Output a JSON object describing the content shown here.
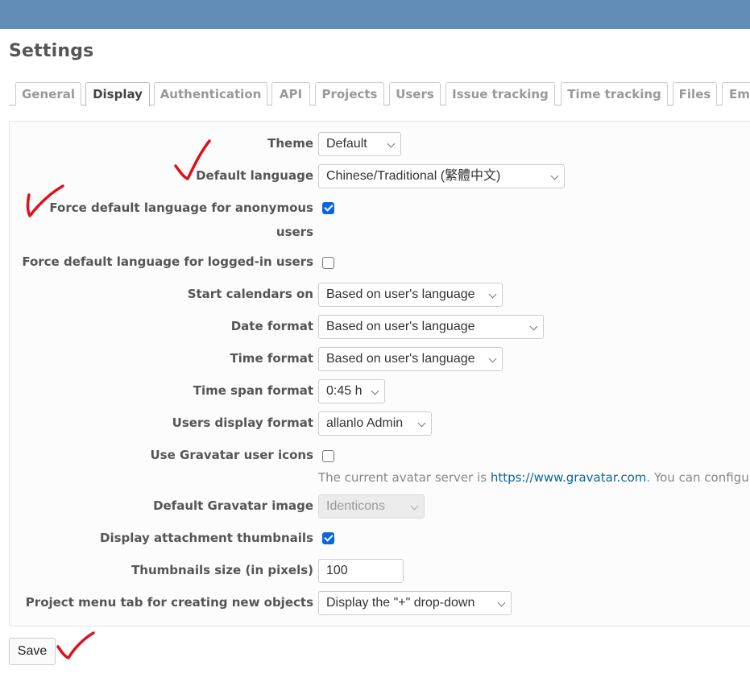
{
  "page": {
    "title": "Settings"
  },
  "tabs": [
    {
      "label": "General",
      "selected": false
    },
    {
      "label": "Display",
      "selected": true
    },
    {
      "label": "Authentication",
      "selected": false
    },
    {
      "label": "API",
      "selected": false
    },
    {
      "label": "Projects",
      "selected": false
    },
    {
      "label": "Users",
      "selected": false
    },
    {
      "label": "Issue tracking",
      "selected": false
    },
    {
      "label": "Time tracking",
      "selected": false
    },
    {
      "label": "Files",
      "selected": false
    },
    {
      "label": "Em",
      "selected": false
    }
  ],
  "form": {
    "theme": {
      "label": "Theme",
      "value": "Default"
    },
    "default_language": {
      "label": "Default language",
      "value": "Chinese/Traditional (繁體中文)"
    },
    "force_lang_anonymous": {
      "label_line1": "Force default language for anonymous",
      "label_line2": "users",
      "checked": true
    },
    "force_lang_logged_in": {
      "label": "Force default language for logged-in users",
      "checked": false
    },
    "start_calendars_on": {
      "label": "Start calendars on",
      "value": "Based on user's language"
    },
    "date_format": {
      "label": "Date format",
      "value": "Based on user's language"
    },
    "time_format": {
      "label": "Time format",
      "value": "Based on user's language"
    },
    "time_span_format": {
      "label": "Time span format",
      "value": "0:45 h"
    },
    "users_display_format": {
      "label": "Users display format",
      "value": "allanlo Admin"
    },
    "use_gravatar": {
      "label": "Use Gravatar user icons",
      "checked": false,
      "note_prefix": "The current avatar server is ",
      "note_link": "https://www.gravatar.com",
      "note_suffix": ". You can configu"
    },
    "default_gravatar_image": {
      "label": "Default Gravatar image",
      "value": "Identicons",
      "disabled": true
    },
    "display_attachment_thumbnails": {
      "label": "Display attachment thumbnails",
      "checked": true
    },
    "thumbnails_size": {
      "label": "Thumbnails size (in pixels)",
      "value": "100"
    },
    "project_menu_tab": {
      "label": "Project menu tab for creating new objects",
      "value": "Display the \"+\" drop-down"
    }
  },
  "actions": {
    "save_label": "Save"
  },
  "annotations": {
    "color": "#e0101a",
    "marks": [
      "checkmark-default-language",
      "checkmark-force-anonymous",
      "checkmark-save"
    ]
  }
}
